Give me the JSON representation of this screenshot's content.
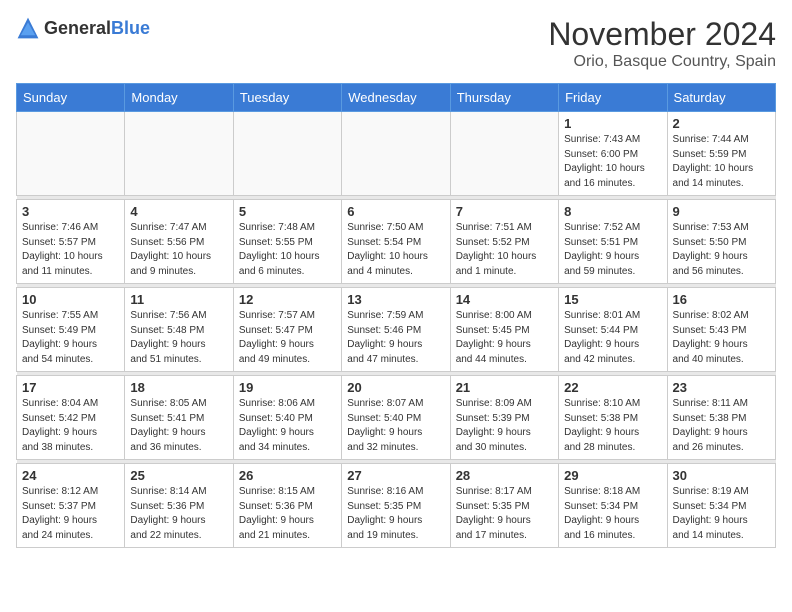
{
  "header": {
    "logo_general": "General",
    "logo_blue": "Blue",
    "month_title": "November 2024",
    "location": "Orio, Basque Country, Spain"
  },
  "calendar": {
    "days_of_week": [
      "Sunday",
      "Monday",
      "Tuesday",
      "Wednesday",
      "Thursday",
      "Friday",
      "Saturday"
    ],
    "weeks": [
      [
        {
          "day": "",
          "info": ""
        },
        {
          "day": "",
          "info": ""
        },
        {
          "day": "",
          "info": ""
        },
        {
          "day": "",
          "info": ""
        },
        {
          "day": "",
          "info": ""
        },
        {
          "day": "1",
          "info": "Sunrise: 7:43 AM\nSunset: 6:00 PM\nDaylight: 10 hours\nand 16 minutes."
        },
        {
          "day": "2",
          "info": "Sunrise: 7:44 AM\nSunset: 5:59 PM\nDaylight: 10 hours\nand 14 minutes."
        }
      ],
      [
        {
          "day": "3",
          "info": "Sunrise: 7:46 AM\nSunset: 5:57 PM\nDaylight: 10 hours\nand 11 minutes."
        },
        {
          "day": "4",
          "info": "Sunrise: 7:47 AM\nSunset: 5:56 PM\nDaylight: 10 hours\nand 9 minutes."
        },
        {
          "day": "5",
          "info": "Sunrise: 7:48 AM\nSunset: 5:55 PM\nDaylight: 10 hours\nand 6 minutes."
        },
        {
          "day": "6",
          "info": "Sunrise: 7:50 AM\nSunset: 5:54 PM\nDaylight: 10 hours\nand 4 minutes."
        },
        {
          "day": "7",
          "info": "Sunrise: 7:51 AM\nSunset: 5:52 PM\nDaylight: 10 hours\nand 1 minute."
        },
        {
          "day": "8",
          "info": "Sunrise: 7:52 AM\nSunset: 5:51 PM\nDaylight: 9 hours\nand 59 minutes."
        },
        {
          "day": "9",
          "info": "Sunrise: 7:53 AM\nSunset: 5:50 PM\nDaylight: 9 hours\nand 56 minutes."
        }
      ],
      [
        {
          "day": "10",
          "info": "Sunrise: 7:55 AM\nSunset: 5:49 PM\nDaylight: 9 hours\nand 54 minutes."
        },
        {
          "day": "11",
          "info": "Sunrise: 7:56 AM\nSunset: 5:48 PM\nDaylight: 9 hours\nand 51 minutes."
        },
        {
          "day": "12",
          "info": "Sunrise: 7:57 AM\nSunset: 5:47 PM\nDaylight: 9 hours\nand 49 minutes."
        },
        {
          "day": "13",
          "info": "Sunrise: 7:59 AM\nSunset: 5:46 PM\nDaylight: 9 hours\nand 47 minutes."
        },
        {
          "day": "14",
          "info": "Sunrise: 8:00 AM\nSunset: 5:45 PM\nDaylight: 9 hours\nand 44 minutes."
        },
        {
          "day": "15",
          "info": "Sunrise: 8:01 AM\nSunset: 5:44 PM\nDaylight: 9 hours\nand 42 minutes."
        },
        {
          "day": "16",
          "info": "Sunrise: 8:02 AM\nSunset: 5:43 PM\nDaylight: 9 hours\nand 40 minutes."
        }
      ],
      [
        {
          "day": "17",
          "info": "Sunrise: 8:04 AM\nSunset: 5:42 PM\nDaylight: 9 hours\nand 38 minutes."
        },
        {
          "day": "18",
          "info": "Sunrise: 8:05 AM\nSunset: 5:41 PM\nDaylight: 9 hours\nand 36 minutes."
        },
        {
          "day": "19",
          "info": "Sunrise: 8:06 AM\nSunset: 5:40 PM\nDaylight: 9 hours\nand 34 minutes."
        },
        {
          "day": "20",
          "info": "Sunrise: 8:07 AM\nSunset: 5:40 PM\nDaylight: 9 hours\nand 32 minutes."
        },
        {
          "day": "21",
          "info": "Sunrise: 8:09 AM\nSunset: 5:39 PM\nDaylight: 9 hours\nand 30 minutes."
        },
        {
          "day": "22",
          "info": "Sunrise: 8:10 AM\nSunset: 5:38 PM\nDaylight: 9 hours\nand 28 minutes."
        },
        {
          "day": "23",
          "info": "Sunrise: 8:11 AM\nSunset: 5:38 PM\nDaylight: 9 hours\nand 26 minutes."
        }
      ],
      [
        {
          "day": "24",
          "info": "Sunrise: 8:12 AM\nSunset: 5:37 PM\nDaylight: 9 hours\nand 24 minutes."
        },
        {
          "day": "25",
          "info": "Sunrise: 8:14 AM\nSunset: 5:36 PM\nDaylight: 9 hours\nand 22 minutes."
        },
        {
          "day": "26",
          "info": "Sunrise: 8:15 AM\nSunset: 5:36 PM\nDaylight: 9 hours\nand 21 minutes."
        },
        {
          "day": "27",
          "info": "Sunrise: 8:16 AM\nSunset: 5:35 PM\nDaylight: 9 hours\nand 19 minutes."
        },
        {
          "day": "28",
          "info": "Sunrise: 8:17 AM\nSunset: 5:35 PM\nDaylight: 9 hours\nand 17 minutes."
        },
        {
          "day": "29",
          "info": "Sunrise: 8:18 AM\nSunset: 5:34 PM\nDaylight: 9 hours\nand 16 minutes."
        },
        {
          "day": "30",
          "info": "Sunrise: 8:19 AM\nSunset: 5:34 PM\nDaylight: 9 hours\nand 14 minutes."
        }
      ]
    ]
  }
}
